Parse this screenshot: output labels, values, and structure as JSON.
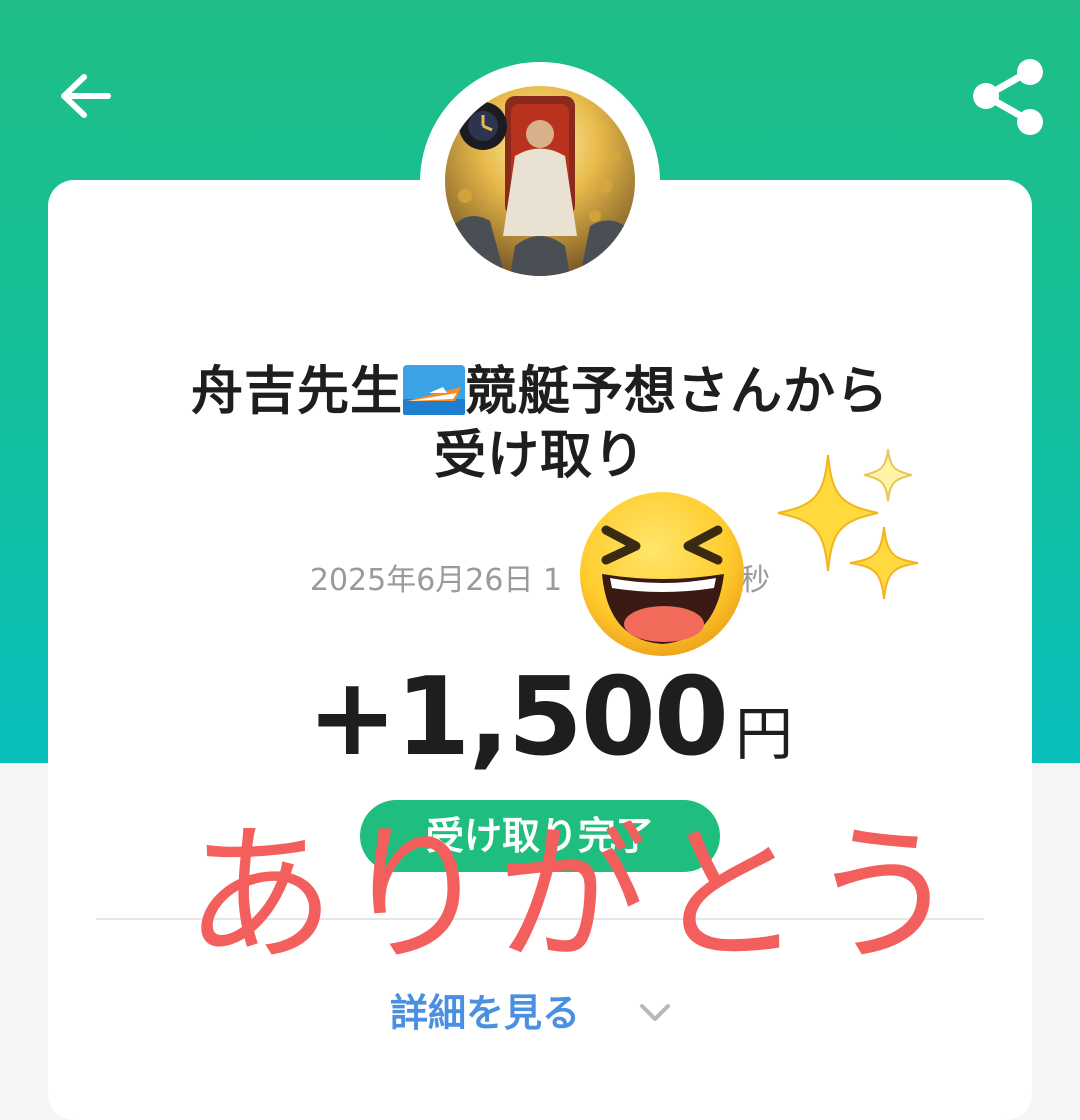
{
  "header": {
    "back_icon": "arrow-left-icon",
    "share_icon": "share-icon",
    "gradient_top": "#1fbe86",
    "gradient_bottom": "#07bfbc"
  },
  "transaction": {
    "title_line1_part1": "舟吉先生",
    "title_emoji": "speedboat-emoji",
    "title_line1_part2": "競艇予想さんから",
    "title_line2": "受け取り",
    "datetime": "2025年6月26日 1",
    "datetime_tail": "秒",
    "amount": "+1,500",
    "currency": "円",
    "status": "受け取り完了",
    "status_color": "#1fbe7e",
    "details_link": "詳細を見る",
    "details_icon": "chevron-down-icon",
    "link_color": "#4b8fe0"
  },
  "overlay": {
    "thanks_text": "ありがとう",
    "thanks_color": "#f25f5c",
    "laugh_emoji": "grinning-squinting-face-emoji",
    "sparkles_emoji": "sparkles-emoji"
  }
}
